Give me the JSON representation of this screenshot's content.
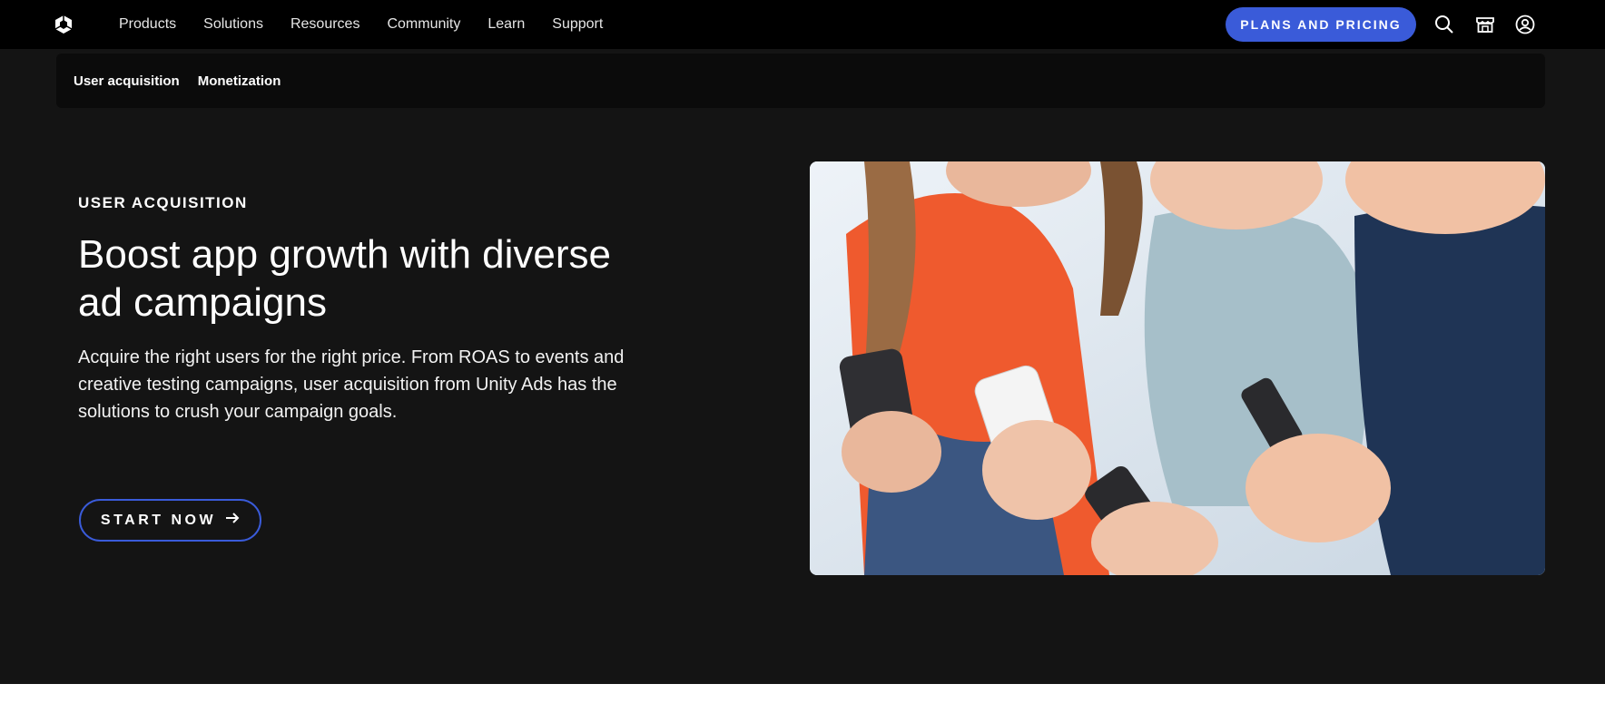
{
  "topnav": {
    "links": [
      "Products",
      "Solutions",
      "Resources",
      "Community",
      "Learn",
      "Support"
    ],
    "plans_label": "PLANS AND PRICING",
    "icons": [
      "unity-logo-icon",
      "search-icon",
      "store-icon",
      "account-icon"
    ]
  },
  "subnav": {
    "items": [
      "User acquisition",
      "Monetization"
    ]
  },
  "hero": {
    "eyebrow": "USER ACQUISITION",
    "headline": "Boost app growth with diverse ad campaigns",
    "body": "Acquire the right users for the right price. From ROAS to events and creative testing campaigns, user acquisition from Unity Ads has the solutions to crush your campaign goals.",
    "cta_label": "START NOW",
    "image": "people-with-phones-photo"
  },
  "colors": {
    "accent": "#3a5bd9",
    "hero_bg": "#141414",
    "nav_bg": "#000000"
  }
}
